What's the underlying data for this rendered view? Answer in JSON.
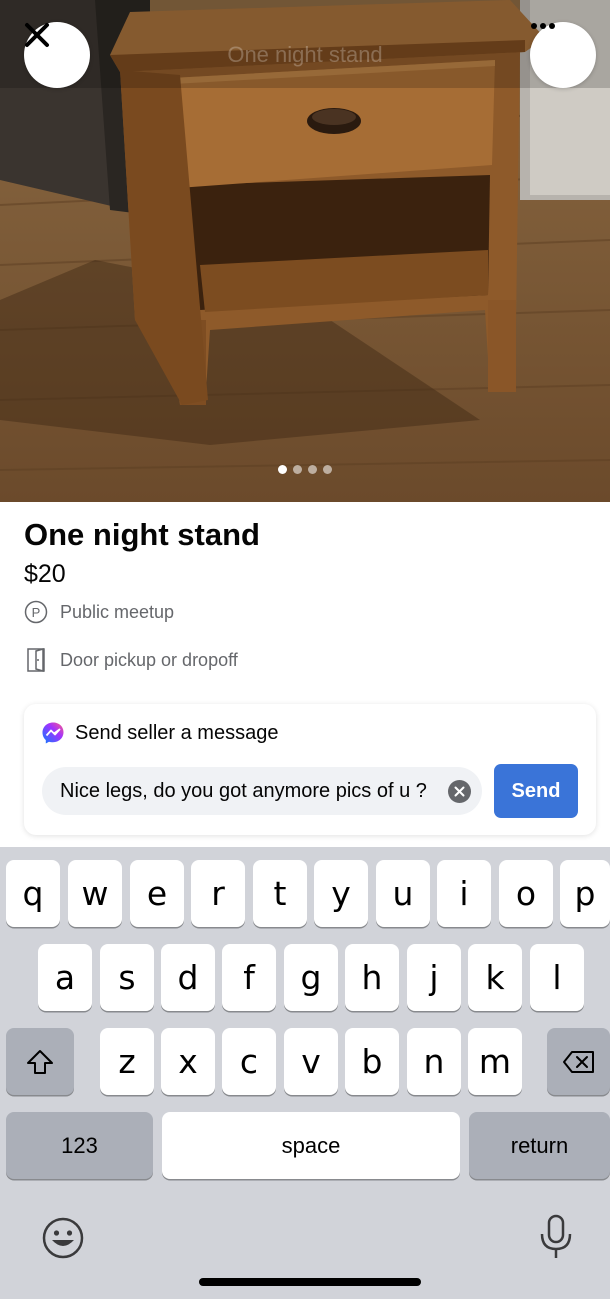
{
  "header": {
    "title": "One night stand",
    "close_icon": "close-icon",
    "more_icon": "more-horizontal-icon"
  },
  "photo": {
    "image_count": 4,
    "active_index": 0
  },
  "listing": {
    "title": "One night stand",
    "price": "$20",
    "details": [
      {
        "icon": "public-meetup-icon",
        "label": "Public meetup"
      },
      {
        "icon": "door-icon",
        "label": "Door pickup or dropoff"
      }
    ]
  },
  "message": {
    "header_label": "Send seller a message",
    "input_value": "Nice legs, do you got anymore pics of u ?",
    "send_label": "Send",
    "accent_color": "#3a74d8"
  },
  "keyboard": {
    "row1": [
      "q",
      "w",
      "e",
      "r",
      "t",
      "y",
      "u",
      "i",
      "o",
      "p"
    ],
    "row2": [
      "a",
      "s",
      "d",
      "f",
      "g",
      "h",
      "j",
      "k",
      "l"
    ],
    "row3": [
      "z",
      "x",
      "c",
      "v",
      "b",
      "n",
      "m"
    ],
    "numbers_label": "123",
    "space_label": "space",
    "return_label": "return"
  }
}
